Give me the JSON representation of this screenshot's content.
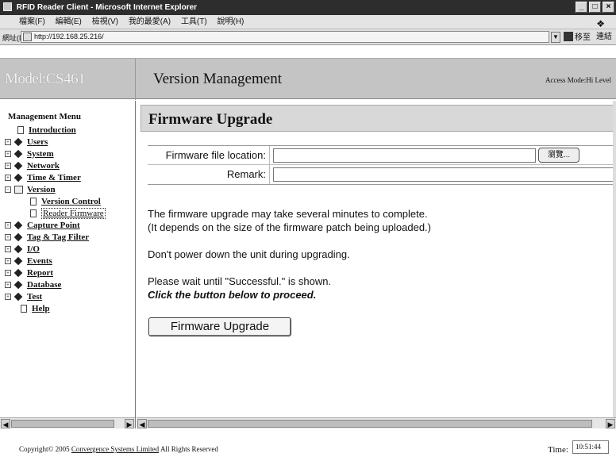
{
  "window": {
    "title": "RFID Reader Client - Microsoft Internet Explorer"
  },
  "menubar": {
    "items": [
      "檔案(F)",
      "編輯(E)",
      "檢視(V)",
      "我的最愛(A)",
      "工具(T)",
      "說明(H)"
    ]
  },
  "addressbar": {
    "label": "網址(D)",
    "url": "http://192.168.25.216/",
    "go_label": "移至",
    "links_label": "連結"
  },
  "header": {
    "model": "Model:CS461",
    "page_heading": "Version Management",
    "access_mode": "Access Mode:Hi Level"
  },
  "sidebar": {
    "title": "Management Menu",
    "items": [
      {
        "label": "Introduction"
      },
      {
        "label": "Users"
      },
      {
        "label": "System"
      },
      {
        "label": "Network"
      },
      {
        "label": "Time & Timer"
      },
      {
        "label": "Version"
      },
      {
        "label": "Version Control"
      },
      {
        "label": "Reader Firmware"
      },
      {
        "label": "Capture Point"
      },
      {
        "label": "Tag & Tag Filter"
      },
      {
        "label": "I/O"
      },
      {
        "label": "Events"
      },
      {
        "label": "Report"
      },
      {
        "label": "Database"
      },
      {
        "label": "Test"
      },
      {
        "label": "Help"
      }
    ]
  },
  "main": {
    "section_title": "Firmware Upgrade",
    "firmware_file_label": "Firmware file location:",
    "firmware_file_value": "",
    "browse_label": "瀏覽...",
    "remark_label": "Remark:",
    "remark_value": "",
    "msg1": "The firmware upgrade may take several minutes to complete.",
    "msg2": "(It depends on the size of the firmware patch being uploaded.)",
    "msg3": "Don't power down the unit during upgrading.",
    "msg4": "Please wait until \"Successful.\" is shown.",
    "msg5": "Click the button below to proceed.",
    "upgrade_button": "Firmware Upgrade"
  },
  "footer": {
    "copyright_prefix": "Copyright© 2005",
    "copyright_link": "Convergence Systems Limited",
    "copyright_suffix": "All Rights Reserved",
    "time_label": "Time:",
    "time_value": "10:51:44"
  }
}
